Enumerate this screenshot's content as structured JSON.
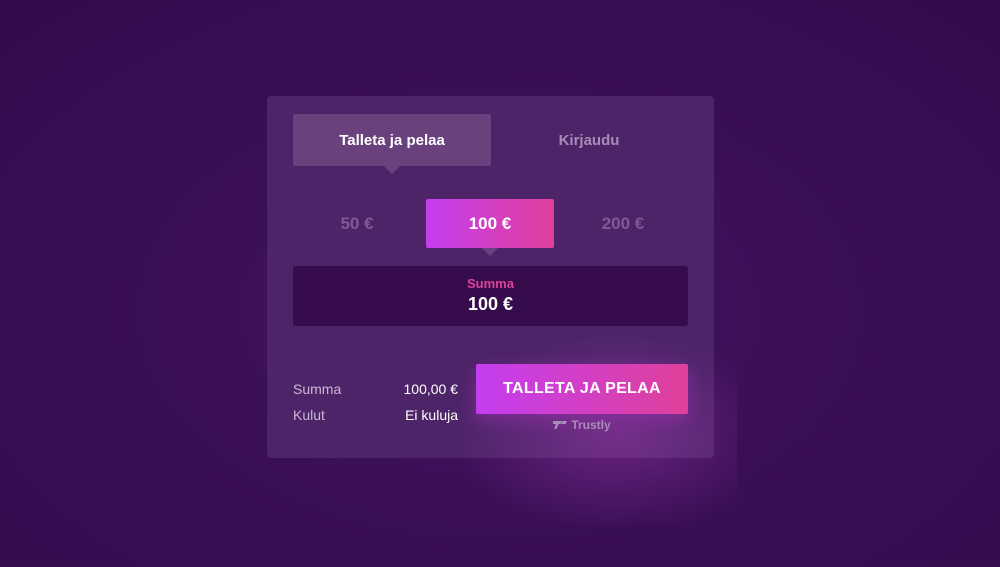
{
  "tabs": [
    {
      "label": "Talleta ja pelaa",
      "active": true
    },
    {
      "label": "Kirjaudu",
      "active": false
    }
  ],
  "amounts": [
    {
      "label": "50 €",
      "selected": false
    },
    {
      "label": "100 €",
      "selected": true
    },
    {
      "label": "200 €",
      "selected": false
    }
  ],
  "sum_box": {
    "label": "Summa",
    "value": "100 €"
  },
  "summary": [
    {
      "label": "Summa",
      "value": "100,00 €"
    },
    {
      "label": "Kulut",
      "value": "Ei kuluja"
    }
  ],
  "cta": {
    "label": "TALLETA JA PELAA"
  },
  "provider": {
    "name": "Trustly",
    "icon": "trustly-logo-icon"
  },
  "colors": {
    "background": "#3a0f55",
    "card": "#4d2468",
    "accent_start": "#c43ef0",
    "accent_end": "#e0409a",
    "sum_label": "#e0409a"
  }
}
